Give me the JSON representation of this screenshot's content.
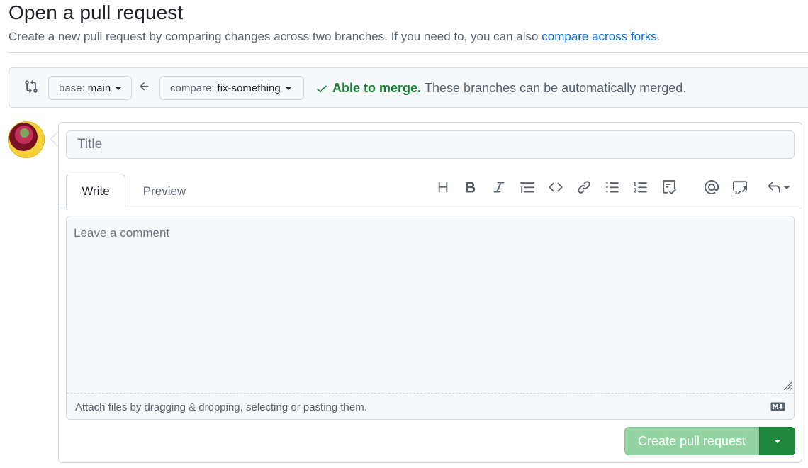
{
  "header": {
    "title": "Open a pull request",
    "subtitle": "Create a new pull request by comparing changes across two branches. If you need to, you can also",
    "subtitle_link": "compare across forks",
    "subtitle_end": "."
  },
  "range": {
    "base_prefix": "base:",
    "base_value": "main",
    "compare_prefix": "compare:",
    "compare_value": "fix-something",
    "merge_ok": "Able to merge.",
    "merge_text": "These branches can be automatically merged."
  },
  "form": {
    "title_placeholder": "Title",
    "tabs": [
      {
        "label": "Write",
        "active": true
      },
      {
        "label": "Preview",
        "active": false
      }
    ],
    "toolbar_icons": [
      "heading-icon",
      "bold-icon",
      "italic-icon",
      "quote-icon",
      "code-icon",
      "link-icon",
      "bulleted-list-icon",
      "numbered-list-icon",
      "task-list-icon",
      "mention-icon",
      "reference-icon",
      "reply-icon"
    ],
    "comment_placeholder": "Leave a comment",
    "attach_text": "Attach files by dragging & dropping, selecting or pasting them.",
    "submit_label": "Create pull request"
  },
  "colors": {
    "link": "#0969da",
    "success": "#1a7f37",
    "button_green": "#1f883d",
    "button_disabled": "#94d3a2"
  }
}
